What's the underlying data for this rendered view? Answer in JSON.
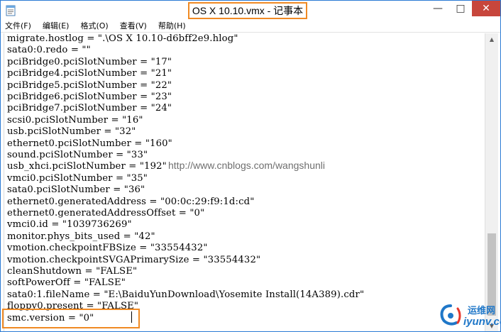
{
  "window": {
    "title": "OS X 10.10.vmx - 记事本",
    "controls": {
      "minimize": "—",
      "maximize": "□",
      "close": "✕"
    }
  },
  "menu": [
    {
      "label": "文件(F)"
    },
    {
      "label": "编辑(E)"
    },
    {
      "label": "格式(O)"
    },
    {
      "label": "查看(V)"
    },
    {
      "label": "帮助(H)"
    }
  ],
  "editor": {
    "lines": [
      "migrate.hostlog = \".\\OS X 10.10-d6bff2e9.hlog\"",
      "sata0:0.redo = \"\"",
      "pciBridge0.pciSlotNumber = \"17\"",
      "pciBridge4.pciSlotNumber = \"21\"",
      "pciBridge5.pciSlotNumber = \"22\"",
      "pciBridge6.pciSlotNumber = \"23\"",
      "pciBridge7.pciSlotNumber = \"24\"",
      "scsi0.pciSlotNumber = \"16\"",
      "usb.pciSlotNumber = \"32\"",
      "ethernet0.pciSlotNumber = \"160\"",
      "sound.pciSlotNumber = \"33\"",
      "usb_xhci.pciSlotNumber = \"192\"",
      "vmci0.pciSlotNumber = \"35\"",
      "sata0.pciSlotNumber = \"36\"",
      "ethernet0.generatedAddress = \"00:0c:29:f9:1d:cd\"",
      "ethernet0.generatedAddressOffset = \"0\"",
      "vmci0.id = \"1039736269\"",
      "monitor.phys_bits_used = \"42\"",
      "vmotion.checkpointFBSize = \"33554432\"",
      "vmotion.checkpointSVGAPrimarySize = \"33554432\"",
      "cleanShutdown = \"FALSE\"",
      "softPowerOff = \"FALSE\"",
      "sata0:1.fileName = \"E:\\BaiduYunDownload\\Yosemite Install(14A389).cdr\"",
      "floppy0.present = \"FALSE\"",
      "smc.version = \"0\""
    ]
  },
  "watermark": "http://www.cnblogs.com/wangshunli",
  "logo": {
    "cn": "运维网",
    "en": "iyunv.com"
  },
  "colors": {
    "highlight": "#f08a24",
    "close_button": "#c7463c",
    "logo": "#1f77c8"
  }
}
